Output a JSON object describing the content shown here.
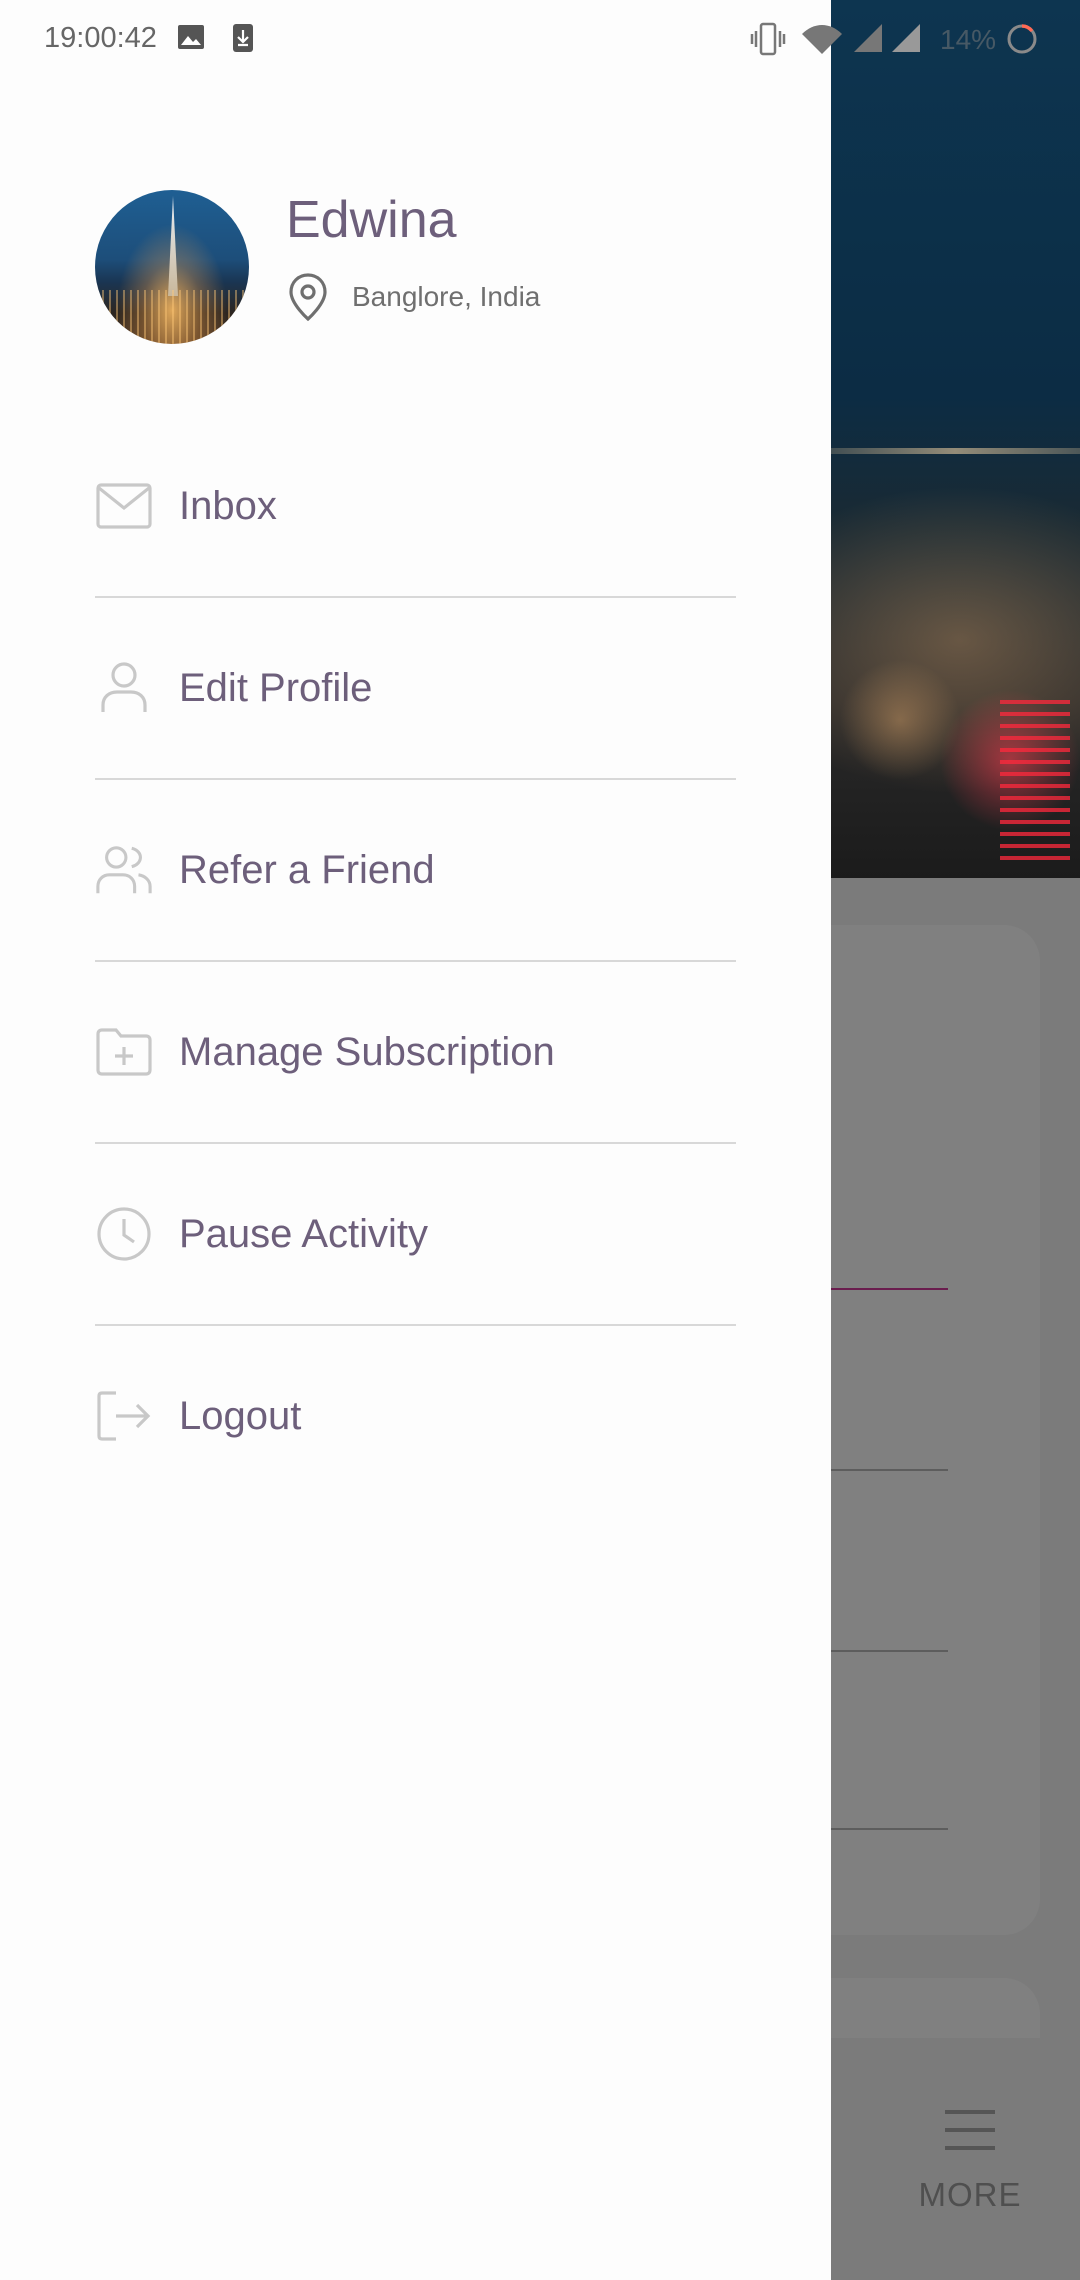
{
  "status_bar": {
    "time": "19:00:42",
    "battery": "14%",
    "icons": [
      "image-icon",
      "download-icon",
      "vibrate-icon",
      "wifi-icon",
      "cell-signal-icon",
      "cell-signal-2-icon",
      "battery-charging-icon"
    ]
  },
  "profile": {
    "name": "Edwina",
    "location": "Banglore, India"
  },
  "menu": {
    "items": [
      {
        "label": "Inbox",
        "icon": "mail-icon"
      },
      {
        "label": "Edit Profile",
        "icon": "user-icon"
      },
      {
        "label": "Refer a Friend",
        "icon": "users-icon"
      },
      {
        "label": "Manage Subscription",
        "icon": "folder-plus-icon"
      },
      {
        "label": "Pause Activity",
        "icon": "clock-icon"
      },
      {
        "label": "Logout",
        "icon": "logout-icon"
      }
    ]
  },
  "background": {
    "more_label": "MORE"
  },
  "colors": {
    "accent": "#6d5f7b",
    "icon": "#c8c8c8",
    "divider": "#d8d8d8",
    "drawer_bg": "#fdfdfd",
    "scrim": "#7b7b7b"
  }
}
